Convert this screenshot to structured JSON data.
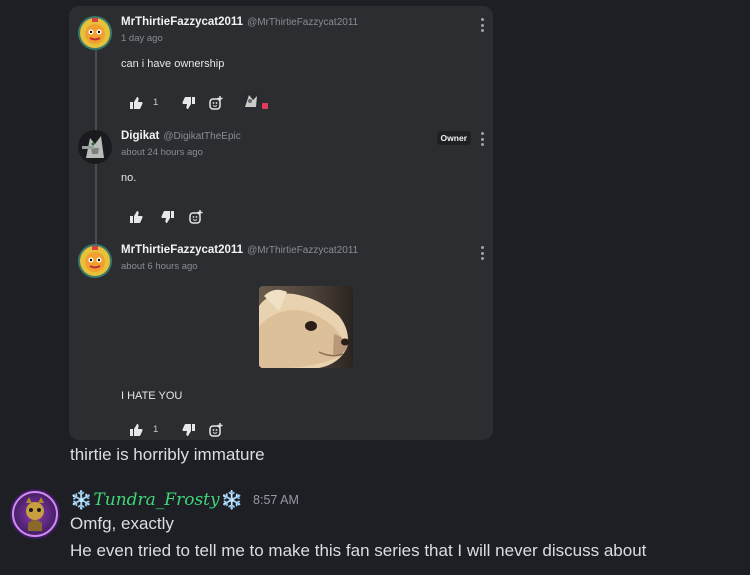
{
  "embed": {
    "comments": [
      {
        "author": "MrThirtieFazzycat2011",
        "handle": "@MrThirtieFazzycat2011",
        "time": "1 day ago",
        "text": "can i have ownership",
        "likes": "1"
      },
      {
        "author": "Digikat",
        "handle": "@DigikatTheEpic",
        "time": "about 24 hours ago",
        "text": "no.",
        "badge": "Owner"
      },
      {
        "author": "MrThirtieFazzycat2011",
        "handle": "@MrThirtieFazzycat2011",
        "time": "about 6 hours ago",
        "text": "I HATE YOU",
        "likes": "1"
      }
    ]
  },
  "chat": {
    "continuation": "thirtie is horribly immature",
    "message": {
      "author_prefix": "❄️",
      "author": "Tundra_Frosty",
      "author_suffix": "❄️",
      "time": "8:57 AM",
      "lines": [
        "Omfg, exactly",
        "He even tried to tell me to make this fan series that I will never discuss about"
      ]
    }
  },
  "colors": {
    "background": "#1e1f24",
    "embed_bg": "#2c2d31",
    "username_green": "#3ed67a"
  }
}
